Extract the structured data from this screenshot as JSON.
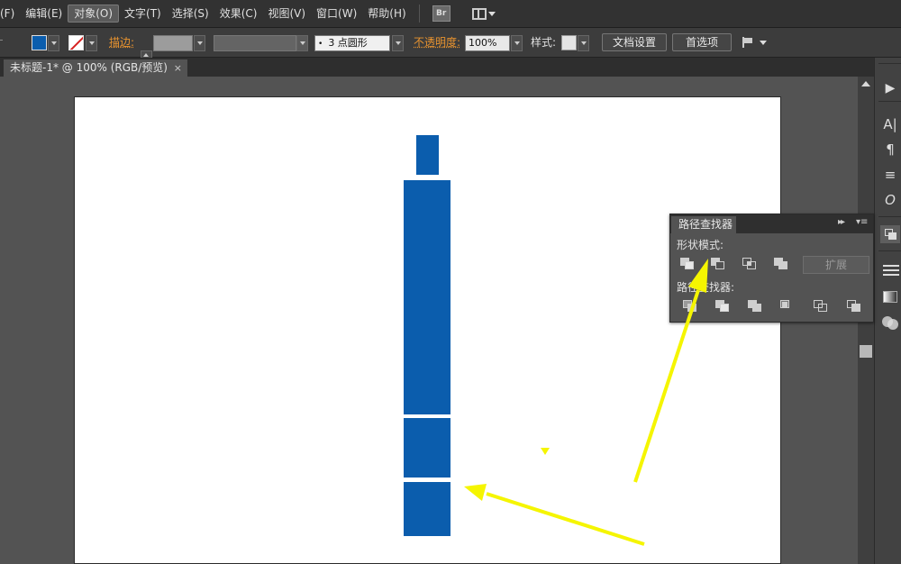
{
  "menu": {
    "items": [
      {
        "label": "(F)",
        "name": "menu-file"
      },
      {
        "label": "编辑(E)",
        "name": "menu-edit"
      },
      {
        "label": "对象(O)",
        "name": "menu-object"
      },
      {
        "label": "文字(T)",
        "name": "menu-type"
      },
      {
        "label": "选择(S)",
        "name": "menu-select"
      },
      {
        "label": "效果(C)",
        "name": "menu-effect"
      },
      {
        "label": "视图(V)",
        "name": "menu-view"
      },
      {
        "label": "窗口(W)",
        "name": "menu-window"
      },
      {
        "label": "帮助(H)",
        "name": "menu-help"
      }
    ],
    "active": "对象(O)",
    "bridge_label": "Br"
  },
  "control": {
    "fill_color": "#0b5dad",
    "stroke_label": "描边:",
    "brush_label": "3 点圆形",
    "opacity_label": "不透明度:",
    "opacity_value": "100%",
    "style_label": "样式:",
    "doc_setup_button": "文档设置",
    "preferences_button": "首选项"
  },
  "document": {
    "tab_title": "未标题-1* @ 100% (RGB/预览)",
    "close_glyph": "×"
  },
  "pathfinder": {
    "tab_label": "路径查找器",
    "collapse_glyph": "▸▸",
    "menu_glyph": "▾≡",
    "shape_modes_label": "形状模式:",
    "pathfinders_label": "路径查找器:",
    "expand_button": "扩展"
  },
  "right_strip_icons": {
    "play": "▶",
    "character": "A|",
    "paragraph": "¶",
    "align": "≡",
    "opentype": "O"
  },
  "colors": {
    "shape_blue": "#0b5dad",
    "arrow_yellow": "#f5f500",
    "accent_orange": "#e8932f"
  }
}
